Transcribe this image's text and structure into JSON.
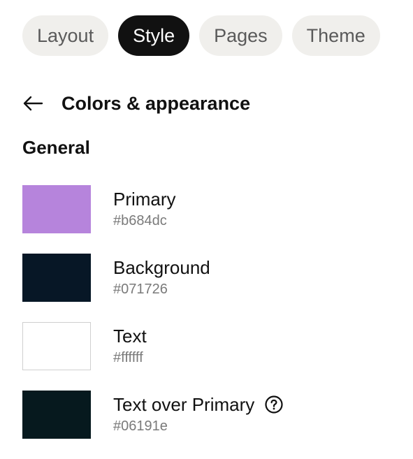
{
  "tabs": [
    {
      "label": "Layout",
      "active": false
    },
    {
      "label": "Style",
      "active": true
    },
    {
      "label": "Pages",
      "active": false
    },
    {
      "label": "Theme",
      "active": false
    }
  ],
  "header": {
    "back_icon": "arrow-left-icon",
    "title": "Colors & appearance"
  },
  "section": {
    "title": "General"
  },
  "colors": [
    {
      "name": "Primary",
      "hex": "#b684dc"
    },
    {
      "name": "Background",
      "hex": "#071726"
    },
    {
      "name": "Text",
      "hex": "#ffffff"
    },
    {
      "name": "Text over Primary",
      "hex": "#06191e",
      "help_icon": "question-circle-icon"
    }
  ]
}
